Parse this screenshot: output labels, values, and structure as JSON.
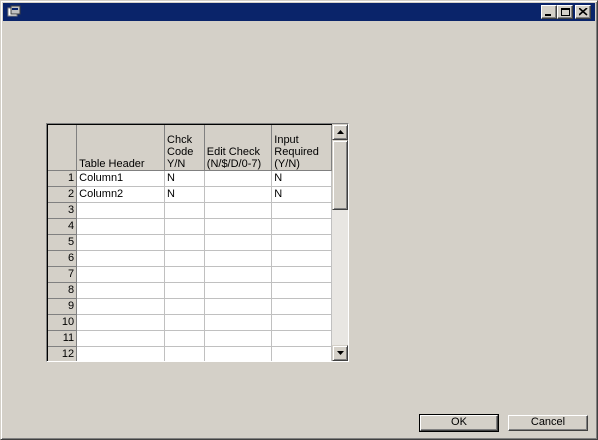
{
  "window": {
    "title": "",
    "controls": {
      "minimize": "minimize-icon",
      "maximize": "maximize-icon",
      "close": "close-icon"
    },
    "titlebar_color": "#0a246a"
  },
  "grid": {
    "columns": [
      "",
      "Table Header",
      "Chck Code Y/N",
      "Edit Check (N/$/D/0-7)",
      "Input Required (Y/N)"
    ],
    "rows": [
      {
        "num": "1",
        "cells": [
          "Column1",
          "N",
          "",
          "N"
        ]
      },
      {
        "num": "2",
        "cells": [
          "Column2",
          "N",
          "",
          "N"
        ]
      },
      {
        "num": "3",
        "cells": [
          "",
          "",
          "",
          ""
        ]
      },
      {
        "num": "4",
        "cells": [
          "",
          "",
          "",
          ""
        ]
      },
      {
        "num": "5",
        "cells": [
          "",
          "",
          "",
          ""
        ]
      },
      {
        "num": "6",
        "cells": [
          "",
          "",
          "",
          ""
        ]
      },
      {
        "num": "7",
        "cells": [
          "",
          "",
          "",
          ""
        ]
      },
      {
        "num": "8",
        "cells": [
          "",
          "",
          "",
          ""
        ]
      },
      {
        "num": "9",
        "cells": [
          "",
          "",
          "",
          ""
        ]
      },
      {
        "num": "10",
        "cells": [
          "",
          "",
          "",
          ""
        ]
      },
      {
        "num": "11",
        "cells": [
          "",
          "",
          "",
          ""
        ]
      },
      {
        "num": "12",
        "cells": [
          "",
          "",
          "",
          ""
        ]
      }
    ]
  },
  "buttons": {
    "ok": "OK",
    "cancel": "Cancel"
  }
}
